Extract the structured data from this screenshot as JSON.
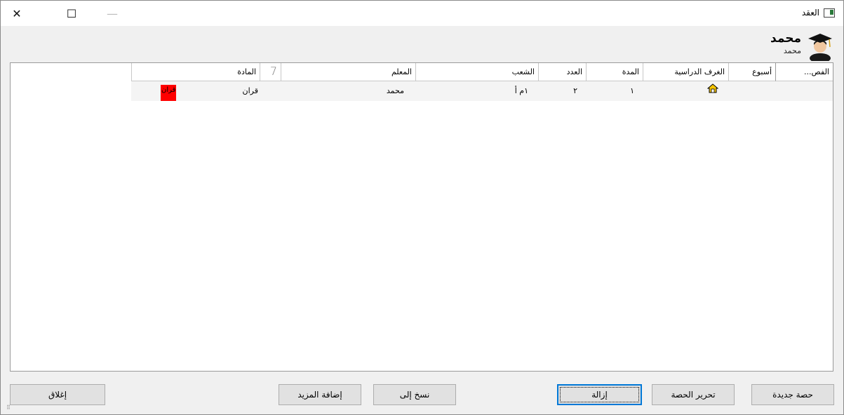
{
  "window": {
    "title": "العقد",
    "controls": {
      "close": "✕",
      "maximize": "☐",
      "minimize": "—"
    }
  },
  "header": {
    "teacher_name": "محمد",
    "teacher_sub": "محمد",
    "avatar_icon": "teacher-graduate-icon"
  },
  "grid": {
    "columns": [
      "المادة",
      "7",
      "المعلم",
      "الشعب",
      "العدد",
      "المدة",
      "الغرف الدراسية",
      "أسبوع",
      "الفص..."
    ],
    "rows": [
      {
        "badge": "قران",
        "subject": "قران",
        "marker": "",
        "teacher": "محمد",
        "classes": "١م أ",
        "count": "٢",
        "duration": "١",
        "rooms_icon": "home-icon",
        "week": "",
        "semester": ""
      }
    ]
  },
  "buttons": {
    "new_lesson": "حصة جديدة",
    "edit_lesson": "تحرير الحصة",
    "remove": "إزالة",
    "copy_to": "نسخ إلى",
    "add_more": "إضافة المزيد",
    "close": "إغلاق"
  },
  "colors": {
    "badge": "#ff0000",
    "focus": "#0078d7"
  }
}
